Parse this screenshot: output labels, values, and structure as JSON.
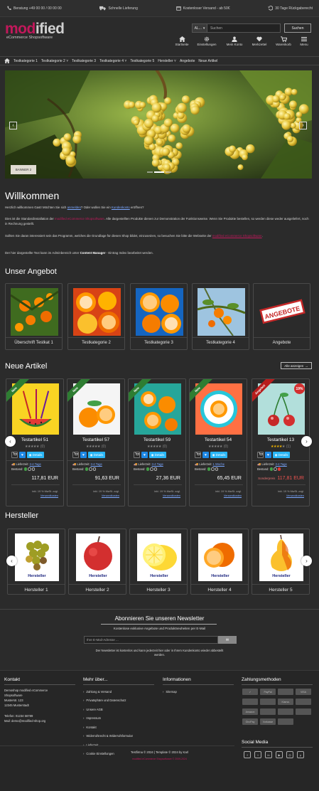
{
  "topbar": {
    "hotline": "Beratung +49 00 00 / 00 00 00",
    "delivery": "Schnelle Lieferung",
    "shipping": "Kostenloser Versand - ab 50€",
    "returns": "30 Tage Rückgaberecht"
  },
  "logo": {
    "name_pink": "mod",
    "name_grey": "ified",
    "tagline": "eCommerce Shopsoftware"
  },
  "search": {
    "select": "AL...",
    "placeholder": "Suchen",
    "button": "Suchen"
  },
  "header_nav": [
    {
      "label": "Startseite",
      "icon": "home-icon"
    },
    {
      "label": "Einstellungen",
      "icon": "gear-icon"
    },
    {
      "label": "Mein Konto",
      "icon": "user-icon"
    },
    {
      "label": "Merkzettel",
      "icon": "heart-icon"
    },
    {
      "label": "Warenkorb",
      "icon": "cart-icon"
    },
    {
      "label": "Menu",
      "icon": "menu-icon"
    }
  ],
  "catnav": [
    "Testkategorie 1",
    "Testkategorie 2",
    "Testkategorie 3",
    "Testkategorie 4",
    "Testkategorie 5",
    "Hersteller",
    "Angebote",
    "Neue Artikel"
  ],
  "banner": {
    "label": "BANNER 2"
  },
  "welcome": {
    "title": "Willkommen",
    "p1a": "Herzlich willkommen Gast! Möchten Sie sich ",
    "p1_link1": "anmelden",
    "p1b": "? Oder wollen Sie ein ",
    "p1_link2": "Kundenkonto",
    "p1c": " eröffnen?",
    "p2a": "Dies ist die Standardinstallation der ",
    "p2_brand": "modified eCommerce Shopsoftware",
    "p2b": ". Alle dargestellten Produkte dienen zur Demonstration der Funktionsweise. Wenn Sie Produkte bestellen, so werden diese weder ausgeliefert, noch in Rechnung gestellt.",
    "p3a": "Sollten Sie daran interessiert sein das Programm, welches die Grundlage für diesen Shop bildet, einzusetzen, so besuchen Sie bitte die Webseite der ",
    "p3_brand": "modified eCommerce Shopsoftware",
    "p3b": ".",
    "p4a": "Der hier dargestellte Text kann im Adminbereich unter ",
    "p4_bold": "Content Manager",
    "p4b": " - Eintrag Index bearbeitet werden."
  },
  "offers": {
    "title": "Unser Angebot",
    "items": [
      "Überschrift Testkat 1",
      "Testkategorie 2",
      "Testkategorie 3",
      "Testkategorie 4",
      "Angebote"
    ],
    "stamp": "ANGEBOTE"
  },
  "new_items": {
    "title": "Neue Artikel",
    "show_all": "Alle anzeigen",
    "products": [
      {
        "name": "Testartikel 51",
        "rating": 0,
        "reviews": "(0)",
        "ribbon": "Neu",
        "delivery_label": "Lieferzeit:",
        "delivery": "3-4 Tage",
        "stock_label": "Bestand:",
        "price": "117,81 EUR",
        "tax": "inkl. 19 % MwSt. zzgl.",
        "shipping": "Versandkosten"
      },
      {
        "name": "Testartikel 57",
        "rating": 0,
        "reviews": "(0)",
        "ribbon": "Neu",
        "delivery_label": "Lieferzeit:",
        "delivery": "3-4 Tage",
        "stock_label": "Bestand:",
        "price": "91,63 EUR",
        "tax": "inkl. 19 % MwSt. zzgl.",
        "shipping": "Versandkosten"
      },
      {
        "name": "Testartikel 59",
        "rating": 0,
        "reviews": "(0)",
        "ribbon": "Neu",
        "delivery_label": "Lieferzeit:",
        "delivery": "3-4 Tage",
        "stock_label": "Bestand:",
        "price": "27,36 EUR",
        "tax": "inkl. 19 % MwSt. zzgl.",
        "shipping": "Versandkosten"
      },
      {
        "name": "Testartikel 54",
        "rating": 0,
        "reviews": "(0)",
        "ribbon": "Neu",
        "delivery_label": "Lieferzeit:",
        "delivery": "1 Woche",
        "stock_label": "Bestand:",
        "price": "65,45 EUR",
        "tax": "inkl. 19 % MwSt. zzgl.",
        "shipping": "Versandkosten"
      },
      {
        "name": "Testartikel 13",
        "rating": 4,
        "reviews": "(1)",
        "ribbon": "Angebot",
        "badge": "19%",
        "delivery_label": "Lieferzeit:",
        "delivery": "3-4 Tage",
        "stock_label": "Bestand:",
        "old_price": "Sonderpreis",
        "price": "117,81 EUR",
        "tax": "inkl. 19 % MwSt. zzgl.",
        "shipping": "Versandkosten"
      }
    ],
    "details": "Details"
  },
  "manufacturers": {
    "title": "Hersteller",
    "items": [
      "Hersteller 1",
      "Hersteller 2",
      "Hersteller 3",
      "Hersteller 4",
      "Hersteller 5"
    ],
    "img_text": "Hersteller"
  },
  "newsletter": {
    "title": "Abonnieren Sie unseren Newsletter",
    "subtitle": "Kostenlose exklusive Angebote und Produktneuheiten per E-Mail",
    "placeholder": "Ihre E-Mail-Adresse ...",
    "note1": "Der Newsletter ist kostenlos und kann jederzeit hier oder in Ihrem Kundenkonto wieder abbestellt",
    "note2": "werden."
  },
  "footer": {
    "contact": {
      "title": "Kontakt",
      "lines": [
        "Demoshop modified eCommerce",
        "Shopsoftware",
        "Musterstr. 123",
        "12345 Musterstadt"
      ],
      "phone": "Telefon: 01234 56789",
      "mail": "Mail: demo@modified-shop.org"
    },
    "more": {
      "title": "Mehr über...",
      "items": [
        "Zahlung & Versand",
        "Privatsphäre und Datenschutz",
        "Unsere AGB",
        "Impressum",
        "Kontakt",
        "Widerrufsrecht & Widerrufsformular",
        "Lieferzeit",
        "Cookie Einstellungen"
      ]
    },
    "info": {
      "title": "Informationen",
      "items": [
        "Sitemap"
      ]
    },
    "payment": {
      "title": "Zahlungsmethoden",
      "items": [
        "✓",
        "PayPal",
        "",
        "VISA",
        "",
        "",
        "Klarna.",
        "",
        "Amazon",
        "",
        "",
        "",
        "GiroPay",
        "Vorkasse",
        ""
      ]
    },
    "social": {
      "title": "Social Media"
    },
    "copyright": "Testfirma © 2024 | Template © 2024 by Karl",
    "powered": "modified eCommerce Shopsoftware © 2009-2024"
  }
}
